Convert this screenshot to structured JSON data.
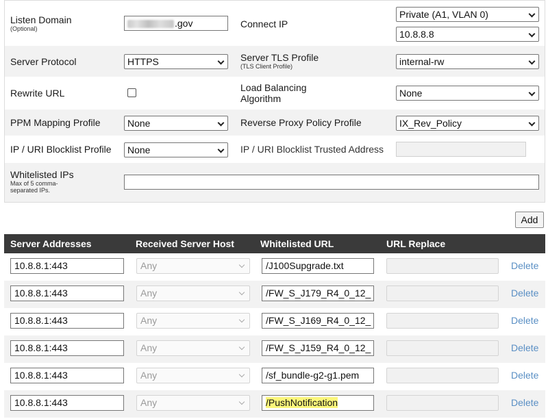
{
  "form": {
    "listen_domain": {
      "label": "Listen Domain",
      "sub": "(Optional)",
      "value_suffix": ".gov"
    },
    "connect_ip": {
      "label": "Connect IP",
      "network": "Private (A1, VLAN 0)",
      "ip": "10.8.8.8"
    },
    "server_protocol": {
      "label": "Server Protocol",
      "value": "HTTPS"
    },
    "server_tls_profile": {
      "label": "Server TLS Profile",
      "sub": "(TLS Client Profile)",
      "value": "internal-rw"
    },
    "rewrite_url": {
      "label": "Rewrite URL",
      "checked": false
    },
    "load_balancing": {
      "label_line1": "Load Balancing",
      "label_line2": "Algorithm",
      "value": "None"
    },
    "ppm_mapping": {
      "label": "PPM Mapping Profile",
      "value": "None"
    },
    "reverse_proxy_policy": {
      "label": "Reverse Proxy Policy Profile",
      "value": "IX_Rev_Policy"
    },
    "blocklist_profile": {
      "label": "IP / URI Blocklist Profile",
      "value": "None"
    },
    "blocklist_trusted": {
      "label": "IP / URI Blocklist Trusted Address",
      "value": ""
    },
    "whitelisted_ips": {
      "label": "Whitelisted IPs",
      "sub_line1": "Max of 5 comma-",
      "sub_line2": "separated IPs.",
      "value": ""
    }
  },
  "add_button": "Add",
  "table": {
    "headers": [
      "Server Addresses",
      "Received Server Host",
      "Whitelisted URL",
      "URL Replace"
    ],
    "delete_label": "Delete",
    "rows": [
      {
        "server": "10.8.8.1:443",
        "host": "Any",
        "url": "/J100Supgrade.txt",
        "replace": ""
      },
      {
        "server": "10.8.8.1:443",
        "host": "Any",
        "url": "/FW_S_J179_R4_0_12_",
        "replace": ""
      },
      {
        "server": "10.8.8.1:443",
        "host": "Any",
        "url": "/FW_S_J169_R4_0_12_",
        "replace": ""
      },
      {
        "server": "10.8.8.1:443",
        "host": "Any",
        "url": "/FW_S_J159_R4_0_12_",
        "replace": ""
      },
      {
        "server": "10.8.8.1:443",
        "host": "Any",
        "url": "/sf_bundle-g2-g1.pem",
        "replace": ""
      },
      {
        "server": "10.8.8.1:443",
        "host": "Any",
        "url": "/PushNotification",
        "replace": "",
        "highlighted": true
      }
    ]
  },
  "colors": {
    "header_bg": "#3a3a3a",
    "delete_link": "#5a8fc4",
    "highlight": "#fbf67a"
  }
}
